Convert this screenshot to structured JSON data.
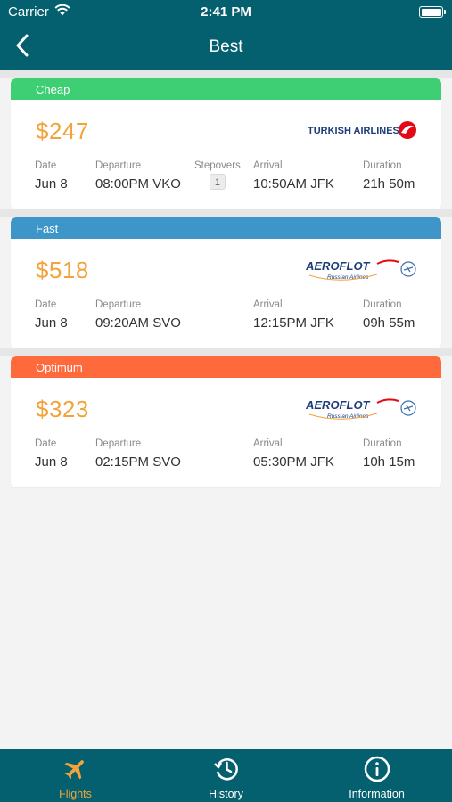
{
  "status_bar": {
    "carrier": "Carrier",
    "time": "2:41 PM"
  },
  "header": {
    "title": "Best"
  },
  "colors": {
    "bar": "#04606f",
    "price": "#f2a33a",
    "cheap": "#3ecf74",
    "fast": "#3d95c8",
    "optimum": "#ff6a3d"
  },
  "flights": [
    {
      "category": "Cheap",
      "price": "$247",
      "airline_logo": "TURKISH AIRLINES",
      "date_label": "Date",
      "date": "Jun 8",
      "departure_label": "Departure",
      "departure": "08:00PM VKO",
      "stopovers_label": "Stepovers",
      "stopovers": "1",
      "arrival_label": "Arrival",
      "arrival": "10:50AM JFK",
      "duration_label": "Duration",
      "duration": "21h 50m"
    },
    {
      "category": "Fast",
      "price": "$518",
      "airline_logo": "AEROFLOT",
      "airline_logo_sub": "Russian Airlines",
      "date_label": "Date",
      "date": "Jun 8",
      "departure_label": "Departure",
      "departure": "09:20AM SVO",
      "arrival_label": "Arrival",
      "arrival": "12:15PM JFK",
      "duration_label": "Duration",
      "duration": "09h 55m"
    },
    {
      "category": "Optimum",
      "price": "$323",
      "airline_logo": "AEROFLOT",
      "airline_logo_sub": "Russian Airlines",
      "date_label": "Date",
      "date": "Jun 8",
      "departure_label": "Departure",
      "departure": "02:15PM SVO",
      "arrival_label": "Arrival",
      "arrival": "05:30PM JFK",
      "duration_label": "Duration",
      "duration": "10h 15m"
    }
  ],
  "tabs": [
    {
      "label": "Flights",
      "icon": "airplane-icon",
      "active": true
    },
    {
      "label": "History",
      "icon": "history-icon",
      "active": false
    },
    {
      "label": "Information",
      "icon": "info-icon",
      "active": false
    }
  ]
}
